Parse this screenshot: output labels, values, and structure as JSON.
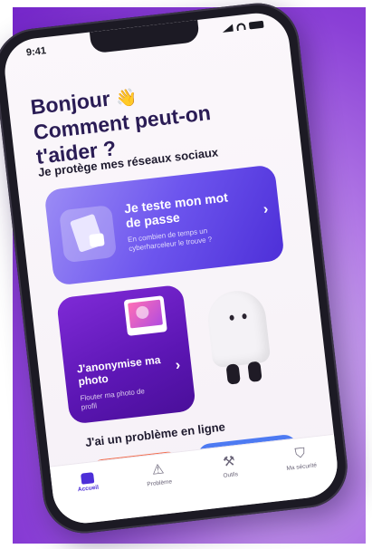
{
  "status": {
    "time": "9:41"
  },
  "greeting": {
    "text": "Bonjour",
    "emoji": "👋",
    "text2": "Comment peut-on t'aider ?"
  },
  "sections": {
    "protect": "Je protège mes réseaux sociaux",
    "problem": "J'ai un problème en ligne"
  },
  "cards": {
    "password": {
      "title": "Je teste mon mot de passe",
      "subtitle": "En combien de temps un cyberharceleur le trouve ?"
    },
    "photo": {
      "title": "J'anonymise ma photo",
      "subtitle": "Flouter ma photo de profil"
    }
  },
  "tabs": [
    {
      "label": "Accueil",
      "icon": "home-icon",
      "active": true
    },
    {
      "label": "Problème",
      "icon": "warning-icon",
      "active": false
    },
    {
      "label": "Outils",
      "icon": "tools-icon",
      "active": false
    },
    {
      "label": "Ma sécurité",
      "icon": "shield-icon",
      "active": false
    }
  ],
  "colors": {
    "background": "#8a3fd6",
    "accent": "#4d2fd8",
    "card_password": "#6d55ee",
    "card_photo": "#5c16b4",
    "peek_orange": "#f26a4a",
    "peek_blue": "#4d7af2"
  }
}
